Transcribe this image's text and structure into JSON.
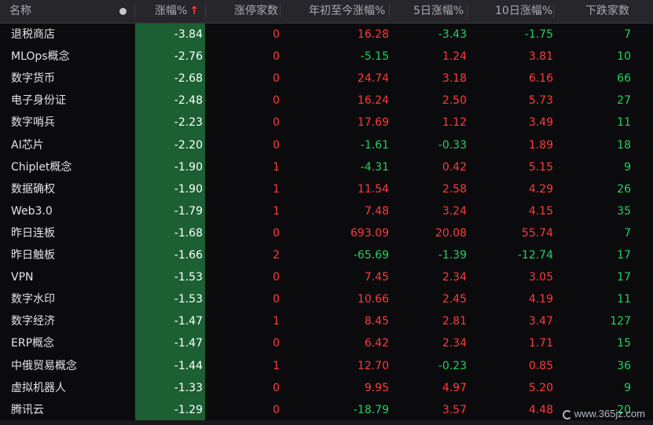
{
  "header": {
    "name": "名称",
    "pct": "涨幅%",
    "sort_arrow": "↑",
    "limit_up": "涨停家数",
    "ytd": "年初至今涨幅%",
    "d5": "5日涨幅%",
    "d10": "10日涨幅%",
    "down_count": "下跌家数"
  },
  "rows": [
    {
      "name": "退税商店",
      "pct": "-3.84",
      "limit": "0",
      "ytd": "16.28",
      "d5": "-3.43",
      "d10": "-1.75",
      "down": "7"
    },
    {
      "name": "MLOps概念",
      "pct": "-2.76",
      "limit": "0",
      "ytd": "-5.15",
      "d5": "1.24",
      "d10": "3.81",
      "down": "10"
    },
    {
      "name": "数字货币",
      "pct": "-2.68",
      "limit": "0",
      "ytd": "24.74",
      "d5": "3.18",
      "d10": "6.16",
      "down": "66"
    },
    {
      "name": "电子身份证",
      "pct": "-2.48",
      "limit": "0",
      "ytd": "16.24",
      "d5": "2.50",
      "d10": "5.73",
      "down": "27"
    },
    {
      "name": "数字哨兵",
      "pct": "-2.23",
      "limit": "0",
      "ytd": "17.69",
      "d5": "1.12",
      "d10": "3.49",
      "down": "11"
    },
    {
      "name": "AI芯片",
      "pct": "-2.20",
      "limit": "0",
      "ytd": "-1.61",
      "d5": "-0.33",
      "d10": "1.89",
      "down": "18"
    },
    {
      "name": "Chiplet概念",
      "pct": "-1.90",
      "limit": "1",
      "ytd": "-4.31",
      "d5": "0.42",
      "d10": "5.15",
      "down": "9"
    },
    {
      "name": "数据确权",
      "pct": "-1.90",
      "limit": "1",
      "ytd": "11.54",
      "d5": "2.58",
      "d10": "4.29",
      "down": "26"
    },
    {
      "name": "Web3.0",
      "pct": "-1.79",
      "limit": "1",
      "ytd": "7.48",
      "d5": "3.24",
      "d10": "4.15",
      "down": "35"
    },
    {
      "name": "昨日连板",
      "pct": "-1.68",
      "limit": "0",
      "ytd": "693.09",
      "d5": "20.08",
      "d10": "55.74",
      "down": "7"
    },
    {
      "name": "昨日触板",
      "pct": "-1.66",
      "limit": "2",
      "ytd": "-65.69",
      "d5": "-1.39",
      "d10": "-12.74",
      "down": "17"
    },
    {
      "name": "VPN",
      "pct": "-1.53",
      "limit": "0",
      "ytd": "7.45",
      "d5": "2.34",
      "d10": "3.05",
      "down": "17"
    },
    {
      "name": "数字水印",
      "pct": "-1.53",
      "limit": "0",
      "ytd": "10.66",
      "d5": "2.45",
      "d10": "4.19",
      "down": "11"
    },
    {
      "name": "数字经济",
      "pct": "-1.47",
      "limit": "1",
      "ytd": "8.45",
      "d5": "2.81",
      "d10": "3.47",
      "down": "127"
    },
    {
      "name": "ERP概念",
      "pct": "-1.47",
      "limit": "0",
      "ytd": "6.42",
      "d5": "2.34",
      "d10": "1.71",
      "down": "15"
    },
    {
      "name": "中俄贸易概念",
      "pct": "-1.44",
      "limit": "1",
      "ytd": "12.70",
      "d5": "-0.23",
      "d10": "0.85",
      "down": "36"
    },
    {
      "name": "虚拟机器人",
      "pct": "-1.33",
      "limit": "0",
      "ytd": "9.95",
      "d5": "4.97",
      "d10": "5.20",
      "down": "9"
    },
    {
      "name": "腾讯云",
      "pct": "-1.29",
      "limit": "0",
      "ytd": "-18.79",
      "d5": "3.57",
      "d10": "4.48",
      "down": "20"
    }
  ],
  "watermark": "www.365jz.com",
  "colors": {
    "up": "#ff3a3a",
    "down": "#1fd35f",
    "sort_column_bg": "#1c5f32"
  }
}
